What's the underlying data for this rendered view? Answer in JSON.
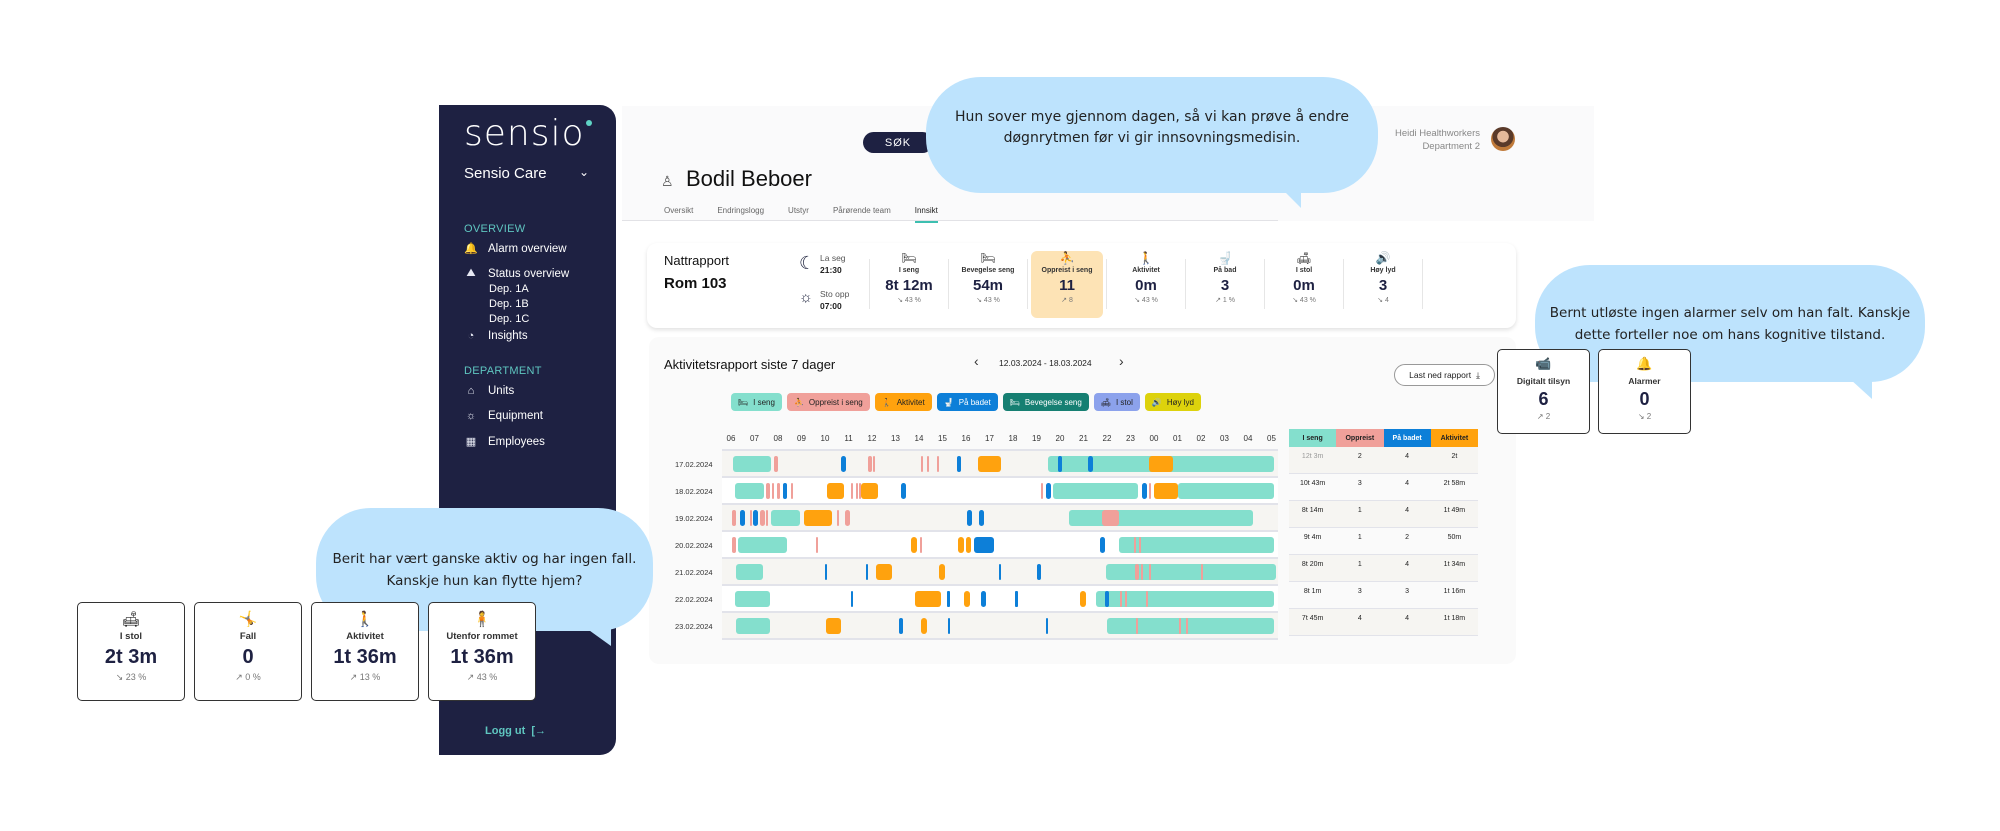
{
  "sidebar": {
    "logo": "sensio",
    "org": "Sensio Care",
    "sections": [
      {
        "title": "OVERVIEW"
      },
      {
        "title": "DEPARTMENT"
      }
    ],
    "overview_items": [
      {
        "label": "Alarm overview",
        "icon": "bell-alarm-icon"
      },
      {
        "label": "Status overview",
        "icon": "area-chart-icon"
      },
      {
        "label": "Insights",
        "icon": "pie-chart-icon"
      }
    ],
    "sub_items": [
      "Dep. 1A",
      "Dep. 1B",
      "Dep. 1C"
    ],
    "department_items": [
      {
        "label": "Units",
        "icon": "home-icon"
      },
      {
        "label": "Equipment",
        "icon": "lightbulb-icon"
      },
      {
        "label": "Employees",
        "icon": "employees-icon"
      }
    ],
    "logout": "Logg ut"
  },
  "header": {
    "search": "SØK",
    "user_name": "Heidi Healthworkers",
    "user_dept": "Department 2",
    "resident": "Bodil Beboer",
    "tabs": [
      "Oversikt",
      "Endringslogg",
      "Utstyr",
      "Pårørende team",
      "Innsikt"
    ],
    "active_tab": "Innsikt"
  },
  "night_report": {
    "title": "Nattrapport",
    "room": "Rom 103",
    "lay_down_label": "La seg",
    "lay_down_time": "21:30",
    "got_up_label": "Sto opp",
    "got_up_time": "07:00",
    "metrics": [
      {
        "label": "I seng",
        "value": "8t 12m",
        "trend": "↘ 43 %",
        "icon": "bed-icon",
        "glyph": "🛏",
        "highlight": false
      },
      {
        "label": "Bevegelse seng",
        "value": "54m",
        "trend": "↘ 43 %",
        "icon": "bed-movement-icon",
        "glyph": "🛏",
        "highlight": false
      },
      {
        "label": "Oppreist i seng",
        "value": "11",
        "trend": "↗ 8",
        "icon": "sitting-up-icon",
        "glyph": "⛹",
        "highlight": true
      },
      {
        "label": "Aktivitet",
        "value": "0m",
        "trend": "↘ 43 %",
        "icon": "walking-icon",
        "glyph": "🚶",
        "highlight": false
      },
      {
        "label": "På bad",
        "value": "3",
        "trend": "↗ 1 %",
        "icon": "toilet-icon",
        "glyph": "🚽",
        "highlight": false
      },
      {
        "label": "I stol",
        "value": "0m",
        "trend": "↘ 43 %",
        "icon": "chair-icon",
        "glyph": "🛋",
        "highlight": false
      },
      {
        "label": "Høy lyd",
        "value": "3",
        "trend": "↘ 4",
        "icon": "speaker-icon",
        "glyph": "🔊",
        "highlight": false
      }
    ]
  },
  "activity_report": {
    "title": "Aktivitetsrapport siste 7 dager",
    "date_range": "12.03.2024 - 18.03.2024",
    "download": "Last ned rapport",
    "legend": [
      {
        "label": "I seng",
        "color": "#84dfcd",
        "icon": "bed-icon",
        "glyph": "🛏"
      },
      {
        "label": "Oppreist i seng",
        "color": "#f0a09a",
        "icon": "sitting-up-icon",
        "glyph": "⛹"
      },
      {
        "label": "Aktivitet",
        "color": "#ffa20e",
        "icon": "walking-icon",
        "glyph": "🚶"
      },
      {
        "label": "På badet",
        "color": "#0d7fd8",
        "icon": "toilet-icon",
        "glyph": "🚽"
      },
      {
        "label": "Bevegelse seng",
        "color": "#167f72",
        "icon": "bed-movement-icon",
        "glyph": "🛏"
      },
      {
        "label": "I stol",
        "color": "#8ca2ec",
        "icon": "chair-icon",
        "glyph": "🛋"
      },
      {
        "label": "Høy lyd",
        "color": "#ddd20c",
        "icon": "speaker-icon",
        "glyph": "🔊"
      }
    ],
    "hours": [
      "06",
      "07",
      "08",
      "09",
      "10",
      "11",
      "12",
      "13",
      "14",
      "15",
      "16",
      "17",
      "18",
      "19",
      "20",
      "21",
      "22",
      "23",
      "00",
      "01",
      "02",
      "03",
      "04",
      "05"
    ],
    "summary_headers": [
      {
        "label": "I seng",
        "color": "#84dfcd"
      },
      {
        "label": "Oppreist",
        "color": "#f0a09a"
      },
      {
        "label": "På badet",
        "color": "#0d7fd8"
      },
      {
        "label": "Aktivitet",
        "color": "#ffa20e"
      }
    ]
  },
  "chart_data": {
    "type": "timeline",
    "title": "Aktivitetsrapport siste 7 dager",
    "x_unit": "hour-of-day (06 to 05 next day, values > 24 wrap)",
    "x_range": [
      6,
      29.2
    ],
    "categories_colors": {
      "bed": "#84dfcd",
      "up": "#f0a09a",
      "activity": "#ffa20e",
      "bath": "#0d7fd8"
    },
    "rows": [
      {
        "date": "17.02.2024",
        "summary": [
          "12t 3m",
          "2",
          "4",
          "2t"
        ],
        "segments": [
          [
            "bed",
            6.1,
            7.7
          ],
          [
            "up",
            7.85,
            8.0
          ],
          [
            "bath",
            10.7,
            10.9
          ],
          [
            "up",
            11.85,
            12.0
          ],
          [
            "up",
            12.05,
            12.1
          ],
          [
            "up",
            14.1,
            14.15
          ],
          [
            "up",
            14.35,
            14.4
          ],
          [
            "up",
            14.75,
            14.8
          ],
          [
            "bath",
            15.6,
            15.8
          ],
          [
            "activity",
            16.5,
            17.5
          ],
          [
            "bed",
            19.5,
            29.1
          ],
          [
            "bath",
            19.9,
            20.1
          ],
          [
            "bath",
            21.2,
            21.4
          ],
          [
            "activity",
            23.8,
            24.8
          ]
        ]
      },
      {
        "date": "18.02.2024",
        "summary": [
          "10t 43m",
          "3",
          "4",
          "2t 58m"
        ],
        "segments": [
          [
            "bed",
            6.15,
            7.4
          ],
          [
            "up",
            7.5,
            7.65
          ],
          [
            "up",
            7.75,
            7.85
          ],
          [
            "up",
            7.95,
            8.1
          ],
          [
            "bath",
            8.2,
            8.4
          ],
          [
            "up",
            8.55,
            8.6
          ],
          [
            "activity",
            10.1,
            10.8
          ],
          [
            "up",
            11.1,
            11.15
          ],
          [
            "up",
            11.3,
            11.35
          ],
          [
            "up",
            11.45,
            11.5
          ],
          [
            "activity",
            11.55,
            12.25
          ],
          [
            "bath",
            13.25,
            13.45
          ],
          [
            "up",
            19.2,
            19.25
          ],
          [
            "bath",
            19.4,
            19.6
          ],
          [
            "bed",
            19.7,
            23.3
          ],
          [
            "bath",
            23.5,
            23.7
          ],
          [
            "up",
            23.8,
            23.85
          ],
          [
            "activity",
            24.0,
            25.0
          ],
          [
            "bed",
            25.0,
            29.1
          ]
        ]
      },
      {
        "date": "19.02.2024",
        "summary": [
          "8t 14m",
          "1",
          "4",
          "1t 49m"
        ],
        "segments": [
          [
            "up",
            6.05,
            6.2
          ],
          [
            "bath",
            6.4,
            6.6
          ],
          [
            "up",
            6.8,
            6.85
          ],
          [
            "bath",
            6.95,
            7.15
          ],
          [
            "up",
            7.25,
            7.45
          ],
          [
            "up",
            7.5,
            7.55
          ],
          [
            "bed",
            7.7,
            8.95
          ],
          [
            "activity",
            9.1,
            10.3
          ],
          [
            "up",
            10.5,
            10.55
          ],
          [
            "up",
            10.85,
            11.05
          ],
          [
            "bath",
            16.05,
            16.25
          ],
          [
            "bath",
            16.55,
            16.75
          ],
          [
            "bed",
            20.4,
            28.2
          ],
          [
            "up",
            21.8,
            22.5
          ]
        ]
      },
      {
        "date": "20.02.2024",
        "summary": [
          "9t 4m",
          "1",
          "2",
          "50m"
        ],
        "segments": [
          [
            "up",
            6.05,
            6.2
          ],
          [
            "bed",
            6.3,
            8.4
          ],
          [
            "up",
            9.6,
            9.65
          ],
          [
            "activity",
            13.65,
            13.9
          ],
          [
            "up",
            14.05,
            14.1
          ],
          [
            "activity",
            15.65,
            15.9
          ],
          [
            "activity",
            16.0,
            16.2
          ],
          [
            "bath",
            16.35,
            17.2
          ],
          [
            "bath",
            21.7,
            21.9
          ],
          [
            "bed",
            22.5,
            29.1
          ],
          [
            "up",
            23.15,
            23.2
          ],
          [
            "up",
            23.35,
            23.4
          ]
        ]
      },
      {
        "date": "21.02.2024",
        "summary": [
          "8t 20m",
          "1",
          "4",
          "1t 34m"
        ],
        "segments": [
          [
            "bed",
            6.2,
            7.35
          ],
          [
            "bath",
            10.0,
            10.1
          ],
          [
            "bath",
            11.75,
            11.85
          ],
          [
            "activity",
            12.15,
            12.85
          ],
          [
            "activity",
            14.85,
            15.1
          ],
          [
            "bath",
            17.4,
            17.5
          ],
          [
            "bath",
            19.0,
            19.2
          ],
          [
            "bed",
            21.95,
            29.2
          ],
          [
            "up",
            23.2,
            23.35
          ],
          [
            "up",
            23.45,
            23.5
          ],
          [
            "up",
            23.8,
            23.85
          ],
          [
            "up",
            26.0,
            26.05
          ]
        ]
      },
      {
        "date": "22.02.2024",
        "summary": [
          "8t 1m",
          "3",
          "3",
          "1t 16m"
        ],
        "segments": [
          [
            "bed",
            6.15,
            7.65
          ],
          [
            "bath",
            11.1,
            11.2
          ],
          [
            "activity",
            13.85,
            14.95
          ],
          [
            "bath",
            15.2,
            15.3
          ],
          [
            "activity",
            15.9,
            16.15
          ],
          [
            "bath",
            16.65,
            16.85
          ],
          [
            "bath",
            18.1,
            18.2
          ],
          [
            "activity",
            20.85,
            21.1
          ],
          [
            "bed",
            21.55,
            29.1
          ],
          [
            "bath",
            21.9,
            22.1
          ],
          [
            "up",
            22.55,
            22.6
          ],
          [
            "up",
            22.75,
            22.8
          ],
          [
            "up",
            23.65,
            23.7
          ]
        ]
      },
      {
        "date": "23.02.2024",
        "summary": [
          "7t 45m",
          "4",
          "4",
          "1t 18m"
        ],
        "segments": [
          [
            "bed",
            6.2,
            7.65
          ],
          [
            "activity",
            10.05,
            10.7
          ],
          [
            "bath",
            13.15,
            13.3
          ],
          [
            "activity",
            14.1,
            14.35
          ],
          [
            "bath",
            15.25,
            15.32
          ],
          [
            "bath",
            19.4,
            19.5
          ],
          [
            "bed",
            22.0,
            29.1
          ],
          [
            "up",
            23.25,
            23.3
          ],
          [
            "up",
            25.05,
            25.1
          ],
          [
            "up",
            25.35,
            25.4
          ]
        ]
      }
    ]
  },
  "bubbles": {
    "top": "Hun sover mye gjennom dagen, så vi kan prøve å endre døgnrytmen før vi gir innsovningsmedisin.",
    "right": "Bernt utløste ingen alarmer selv om han falt. Kanskje dette forteller noe om hans kognitive tilstand.",
    "left": "Berit har vært ganske aktiv og har ingen fall. Kanskje hun kan flytte hjem?"
  },
  "stat_cards_left": [
    {
      "label": "I stol",
      "value": "2t 3m",
      "trend": "↘ 23 %",
      "icon": "armchair-icon",
      "glyph": "🛋"
    },
    {
      "label": "Fall",
      "value": "0",
      "trend": "↗ 0 %",
      "icon": "falling-person-icon",
      "glyph": "🤸"
    },
    {
      "label": "Aktivitet",
      "value": "1t 36m",
      "trend": "↗ 13 %",
      "icon": "walking-icon",
      "glyph": "🚶"
    },
    {
      "label": "Utenfor rommet",
      "value": "1t 36m",
      "trend": "↗ 43 %",
      "icon": "person-icon",
      "glyph": "🧍"
    }
  ],
  "stat_cards_right": [
    {
      "label": "Digitalt tilsyn",
      "value": "6",
      "trend": "↗ 2",
      "icon": "video-camera-icon",
      "glyph": "📹"
    },
    {
      "label": "Alarmer",
      "value": "0",
      "trend": "↘ 2",
      "icon": "bell-alarm-icon",
      "glyph": "🔔"
    }
  ]
}
